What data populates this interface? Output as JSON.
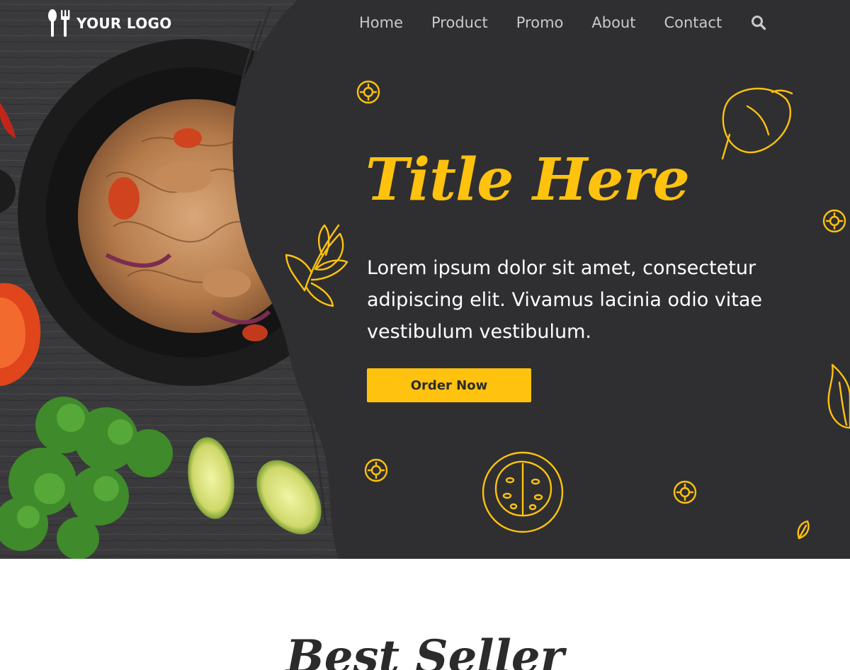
{
  "header": {
    "logo_text": "YOUR LOGO",
    "nav": [
      "Home",
      "Product",
      "Promo",
      "About",
      "Contact"
    ]
  },
  "hero": {
    "title": "Title Here",
    "description": "Lorem ipsum dolor sit amet, consectetur adipiscing elit. Vivamus lacinia odio vitae vestibulum vestibulum.",
    "cta_label": "Order Now"
  },
  "section": {
    "title": "Best Seller"
  },
  "colors": {
    "accent": "#ffc20e",
    "panel": "#2f2f31",
    "background": "#ffffff",
    "nav_text": "#c9c9c9"
  },
  "icons": [
    "fork-spoon-logo-icon",
    "search-icon",
    "parsley-doodle-icon",
    "pepper-doodle-icon",
    "tomato-doodle-icon",
    "garlic-doodle-icon",
    "spice-doodle-icon",
    "leaf-doodle-icon"
  ]
}
